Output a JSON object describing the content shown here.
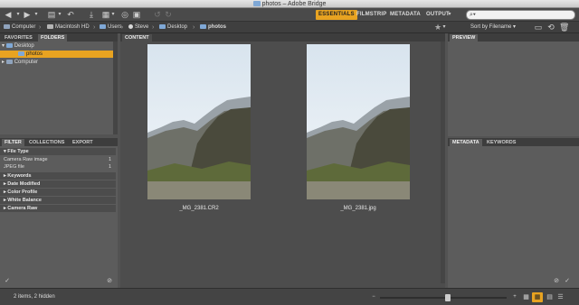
{
  "window": {
    "title": "photos – Adobe Bridge"
  },
  "toolbar": {
    "workspaces": [
      "ESSENTIALS",
      "FILMSTRIP",
      "METADATA",
      "OUTPUT"
    ],
    "active_workspace": "ESSENTIALS",
    "search": {
      "value": "",
      "placeholder": "⌕▾"
    }
  },
  "path": {
    "items": [
      "Computer",
      "Macintosh HD",
      "Users",
      "Steve",
      "Desktop",
      "photos"
    ],
    "sort_label": "Sort by Filename"
  },
  "left_top_panel": {
    "tabs": [
      "FAVORITES",
      "FOLDERS"
    ],
    "active_tab": "FOLDERS",
    "tree": [
      {
        "label": "Desktop",
        "level": 0,
        "expanded": true
      },
      {
        "label": "photos",
        "level": 1,
        "selected": true
      },
      {
        "label": "Computer",
        "level": 0,
        "expanded": false
      }
    ]
  },
  "filter_panel": {
    "tabs": [
      "FILTER",
      "COLLECTIONS",
      "EXPORT"
    ],
    "active_tab": "FILTER",
    "sections": [
      {
        "label": "File Type",
        "items": [
          {
            "label": "Camera Raw image",
            "count": "1"
          },
          {
            "label": "JPEG file",
            "count": "1"
          }
        ]
      },
      {
        "label": "Keywords",
        "items": []
      },
      {
        "label": "Date Modified",
        "items": []
      },
      {
        "label": "Color Profile",
        "items": []
      },
      {
        "label": "White Balance",
        "items": []
      },
      {
        "label": "Camera Raw",
        "items": []
      }
    ]
  },
  "content": {
    "tab": "CONTENT",
    "files": [
      {
        "name": "_MG_2381.CR2"
      },
      {
        "name": "_MG_2381.jpg"
      }
    ]
  },
  "right_panels": {
    "preview_tab": "PREVIEW",
    "meta_tabs": [
      "METADATA",
      "KEYWORDS"
    ],
    "active_meta_tab": "METADATA"
  },
  "status": {
    "text": "2 items, 2 hidden"
  },
  "colors": {
    "accent": "#e8a321",
    "panel": "#5c5c5c",
    "content_bg": "#4d4d4d"
  }
}
